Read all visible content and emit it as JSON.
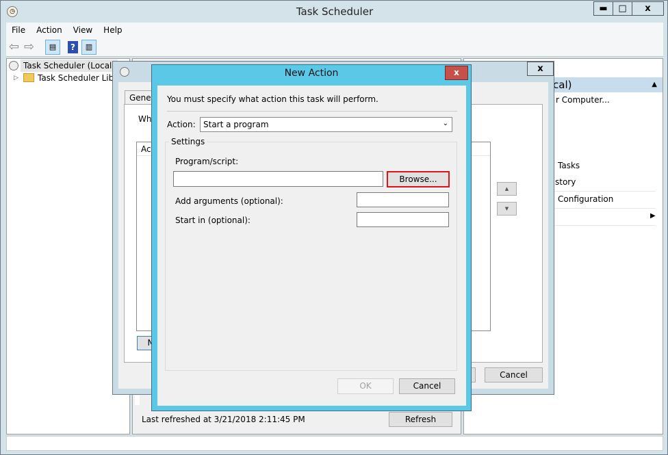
{
  "window": {
    "title": "Task Scheduler",
    "minimize": "▬",
    "maximize": "□",
    "close": "x"
  },
  "menu": [
    "File",
    "Action",
    "View",
    "Help"
  ],
  "toolbar": {
    "back": "⇦",
    "forward": "⇨",
    "help": "?"
  },
  "tree": {
    "root": "Task Scheduler (Local)",
    "library": "Task Scheduler Library"
  },
  "actions_pane": {
    "header": "cal)",
    "items": [
      "r Computer...",
      "Tasks",
      "story",
      "Configuration"
    ]
  },
  "middle": {
    "last_refreshed": "Last refreshed at 3/21/2018 2:11:45 PM",
    "refresh": "Refresh"
  },
  "create_task": {
    "close": "x",
    "tab": "Gener",
    "when_text": "Whe",
    "list_header": "Act",
    "new_button": "N",
    "cancel": "Cancel",
    "up": "▲",
    "down": "▼"
  },
  "new_action": {
    "title": "New Action",
    "close": "x",
    "instruction": "You must specify what action this task will perform.",
    "action_label": "Action:",
    "action_value": "Start a program",
    "settings_label": "Settings",
    "program_label": "Program/script:",
    "program_value": "",
    "browse": "Browse...",
    "arguments_label": "Add arguments (optional):",
    "arguments_value": "",
    "start_in_label": "Start in (optional):",
    "start_in_value": "",
    "ok": "OK",
    "cancel": "Cancel"
  },
  "colors": {
    "dialog_frame": "#5bc8e8",
    "close_red": "#c7504a",
    "browse_highlight": "#e0121a"
  }
}
